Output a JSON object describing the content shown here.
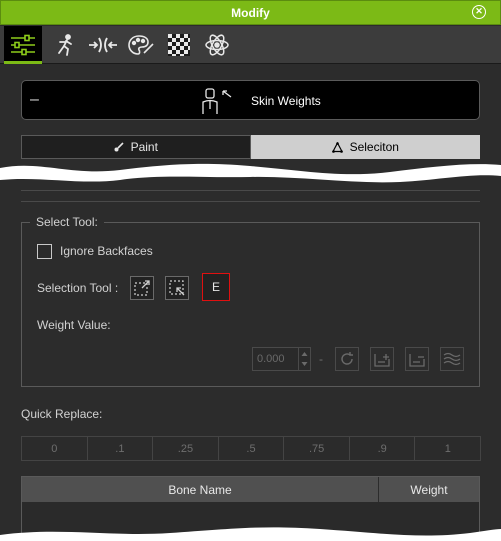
{
  "window": {
    "title": "Modify"
  },
  "toolbar": {
    "tools": [
      {
        "icon": "sliders-icon",
        "active": true
      },
      {
        "icon": "running-figure-icon",
        "active": false
      },
      {
        "icon": "merge-arrows-icon",
        "active": false
      },
      {
        "icon": "palette-icon",
        "active": false
      },
      {
        "icon": "checkerboard-icon",
        "active": false
      },
      {
        "icon": "atom-icon",
        "active": false
      }
    ],
    "accent_color": "#7cba16"
  },
  "skin": {
    "collapse_symbol": "–",
    "label": "Skin Weights"
  },
  "tabs": {
    "paint": "Paint",
    "selection": "Seleciton",
    "selected": "selection"
  },
  "select_tool": {
    "group_title": "Select Tool:",
    "ignore_backfaces_label": "Ignore Backfaces",
    "ignore_backfaces_checked": false,
    "selection_tool_label": "Selection Tool :",
    "e_button_label": "E",
    "weight_value_label": "Weight Value:",
    "weight_value": "0.000",
    "range_separator": "-"
  },
  "quick_replace": {
    "label": "Quick Replace:",
    "values": [
      "0",
      ".1",
      ".25",
      ".5",
      ".75",
      ".9",
      "1"
    ]
  },
  "table": {
    "columns": [
      "Bone Name",
      "Weight"
    ]
  }
}
